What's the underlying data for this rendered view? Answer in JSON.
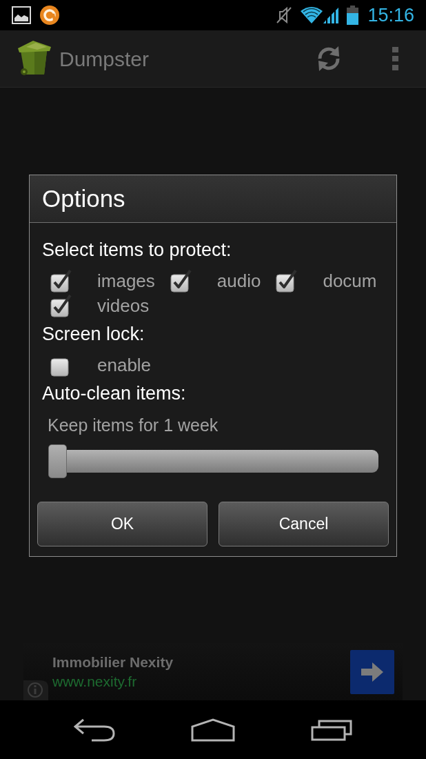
{
  "status_bar": {
    "time": "15:16"
  },
  "action_bar": {
    "title": "Dumpster"
  },
  "dialog": {
    "title": "Options",
    "sections": [
      {
        "kind": "checkboxes",
        "heading": "Select items to protect:",
        "options": [
          {
            "label": "images",
            "checked": true
          },
          {
            "label": "audio",
            "checked": true
          },
          {
            "label": "docum",
            "checked": true
          },
          {
            "label": "videos",
            "checked": true
          }
        ]
      },
      {
        "kind": "checkboxes",
        "heading": "Screen lock:",
        "options": [
          {
            "label": "enable",
            "checked": false
          }
        ]
      },
      {
        "kind": "slider",
        "heading": "Auto-clean items:",
        "slider": {
          "label": "Keep items for 1 week",
          "level": 0
        }
      }
    ],
    "buttons": [
      {
        "label": "OK"
      },
      {
        "label": "Cancel"
      }
    ]
  },
  "ad": {
    "title": "Immobilier Nexity",
    "url": "www.nexity.fr"
  }
}
